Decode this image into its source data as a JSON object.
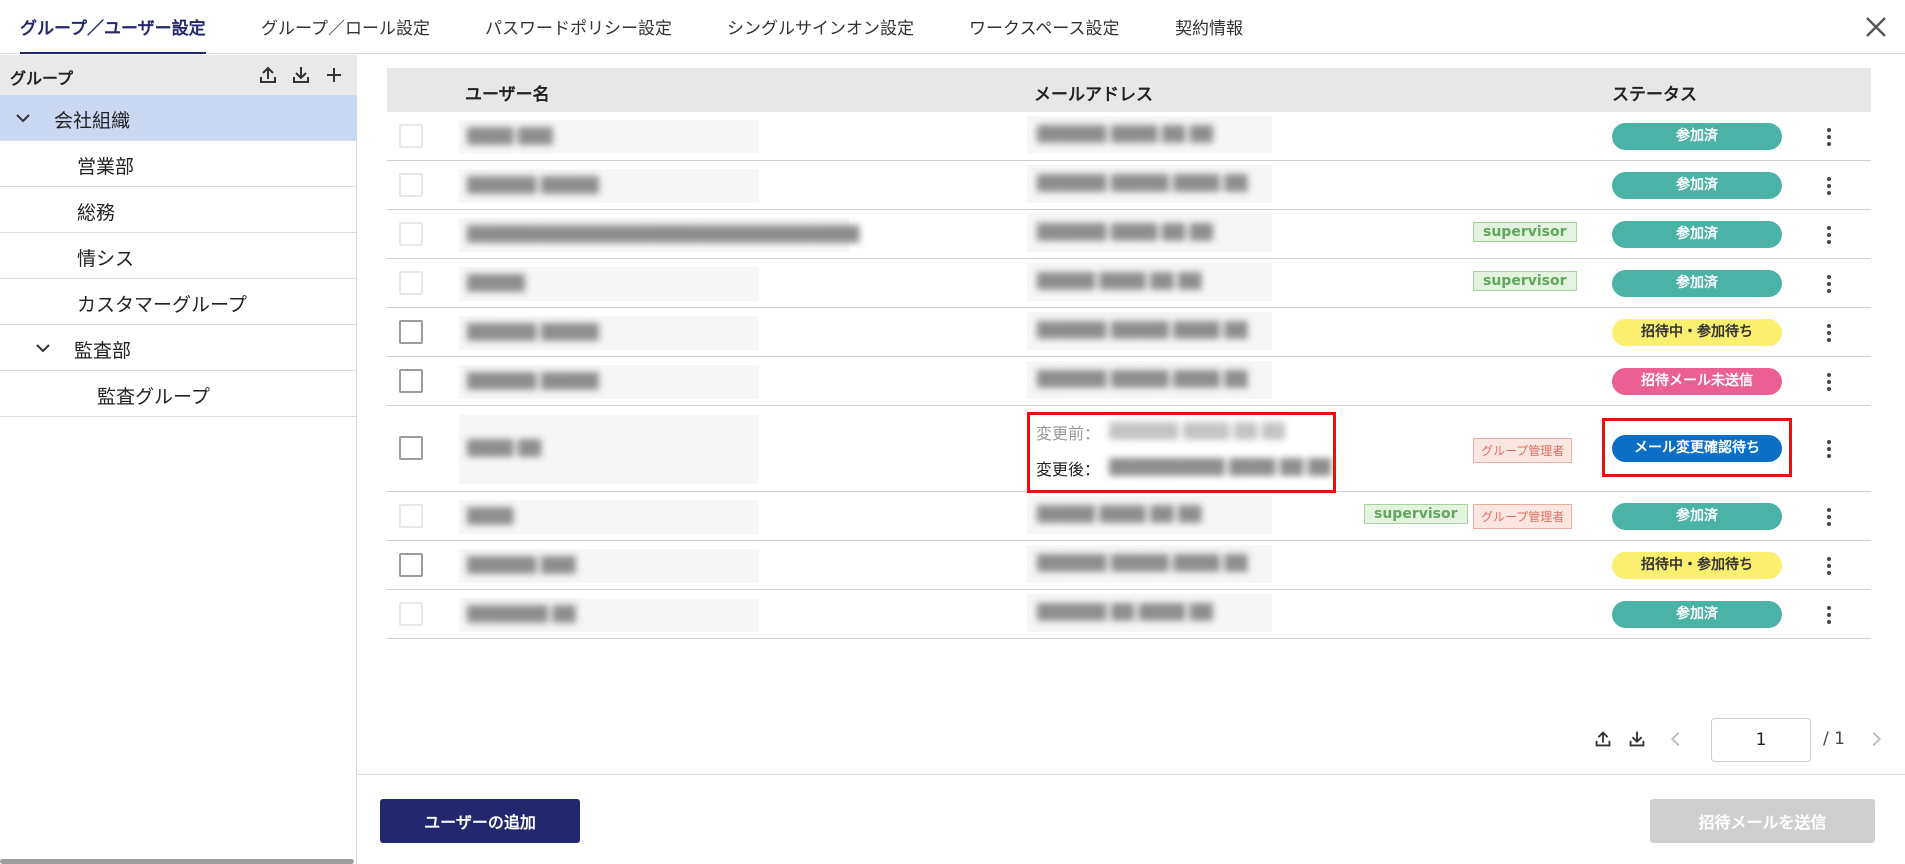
{
  "tabs": [
    {
      "label": "グループ／ユーザー設定",
      "active": true
    },
    {
      "label": "グループ／ロール設定"
    },
    {
      "label": "パスワードポリシー設定"
    },
    {
      "label": "シングルサインオン設定"
    },
    {
      "label": "ワークスペース設定"
    },
    {
      "label": "契約情報"
    }
  ],
  "sidebar": {
    "title": "グループ",
    "tree": [
      {
        "label": "会社組織",
        "expanded": true,
        "selected": true
      },
      {
        "label": "営業部"
      },
      {
        "label": "総務"
      },
      {
        "label": "情シス"
      },
      {
        "label": "カスタマーグループ"
      },
      {
        "label": "監査部",
        "expanded": true
      },
      {
        "label": "監査グループ"
      }
    ]
  },
  "table": {
    "headers": {
      "username": "ユーザー名",
      "email": "メールアドレス",
      "status": "ステータス"
    },
    "rows": [
      {
        "status": "参加済",
        "status_color": "#4ab3a6"
      },
      {
        "status": "参加済",
        "status_color": "#4ab3a6"
      },
      {
        "roles": [
          "supervisor"
        ],
        "status": "参加済",
        "status_color": "#4ab3a6"
      },
      {
        "roles": [
          "supervisor"
        ],
        "status": "参加済",
        "status_color": "#4ab3a6"
      },
      {
        "status": "招待中・参加待ち",
        "status_color": "#fbef6f"
      },
      {
        "status": "招待メール未送信",
        "status_color": "#ec5f95"
      },
      {
        "email_before_label": "変更前：",
        "email_after_label": "変更後：",
        "roles": [
          "グループ管理者"
        ],
        "status": "メール変更確認待ち",
        "status_color": "#0b6fc6"
      },
      {
        "roles": [
          "supervisor",
          "グループ管理者"
        ],
        "status": "参加済",
        "status_color": "#4ab3a6"
      },
      {
        "status": "招待中・参加待ち",
        "status_color": "#fbef6f"
      },
      {
        "status": "参加済",
        "status_color": "#4ab3a6"
      }
    ]
  },
  "pagination": {
    "current": "1",
    "total": "/ 1"
  },
  "footer": {
    "add_user_label": "ユーザーの追加",
    "send_invite_label": "招待メールを送信"
  },
  "colors": {
    "accent": "#23286e",
    "highlight": "#e8100c"
  }
}
